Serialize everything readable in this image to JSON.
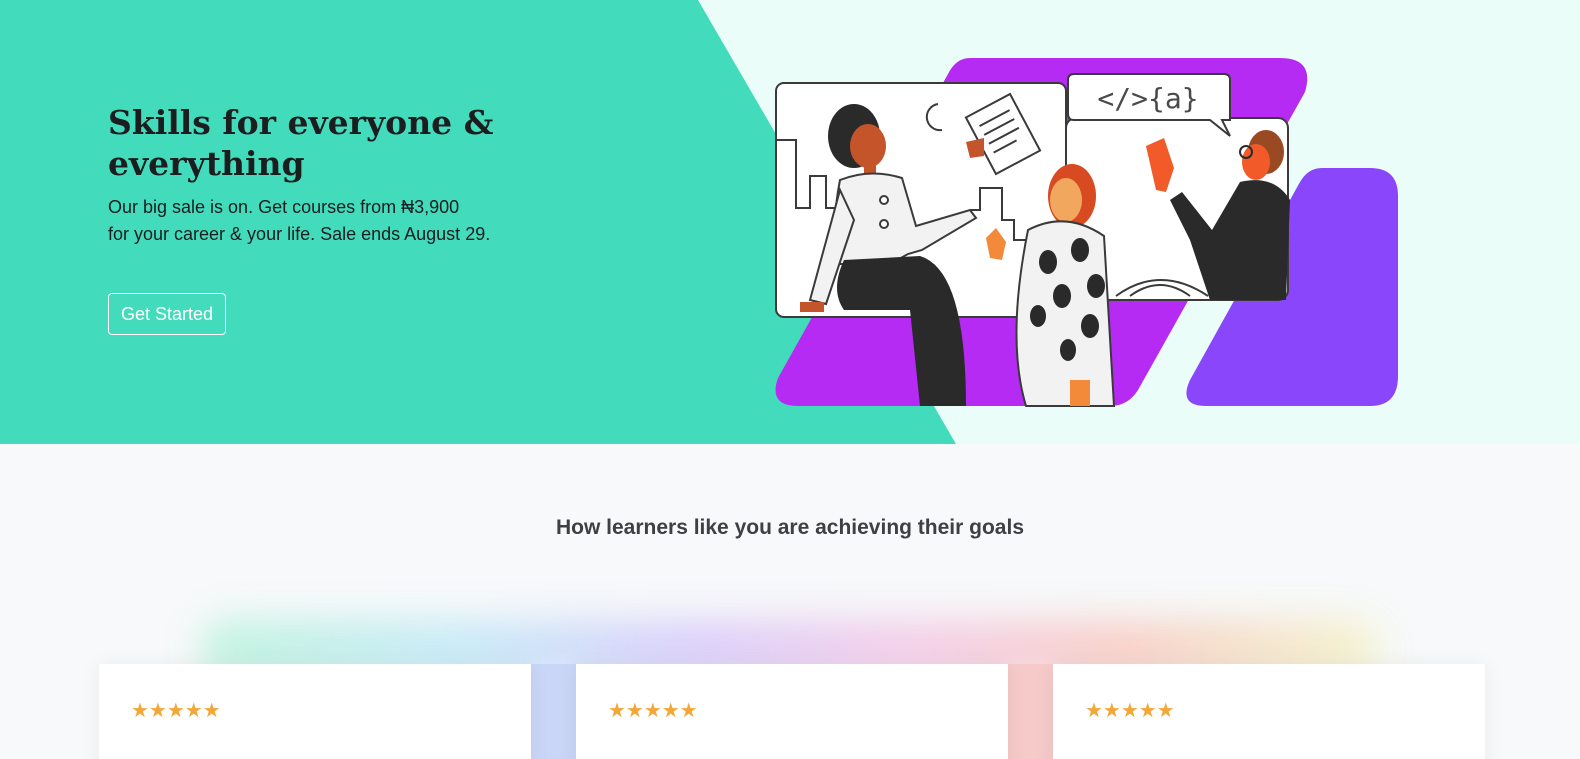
{
  "hero": {
    "title": "Skills for everyone & everything",
    "subtitle_line1": "Our big sale is on. Get courses from ₦3,900",
    "subtitle_line2": "for your career & your life. Sale ends August 29.",
    "cta_label": "Get Started",
    "code_bubble": "</>{a}"
  },
  "colors": {
    "hero_green": "#42dcbc",
    "hero_light": "#eafdf9",
    "purple_primary": "#b62bf4",
    "purple_secondary": "#8a46fb",
    "star": "#f3a738"
  },
  "section": {
    "heading": "How learners like you are achieving their goals"
  },
  "testimonials": [
    {
      "rating": 5,
      "stars": "★★★★★"
    },
    {
      "rating": 5,
      "stars": "★★★★★"
    },
    {
      "rating": 5,
      "stars": "★★★★★"
    }
  ]
}
